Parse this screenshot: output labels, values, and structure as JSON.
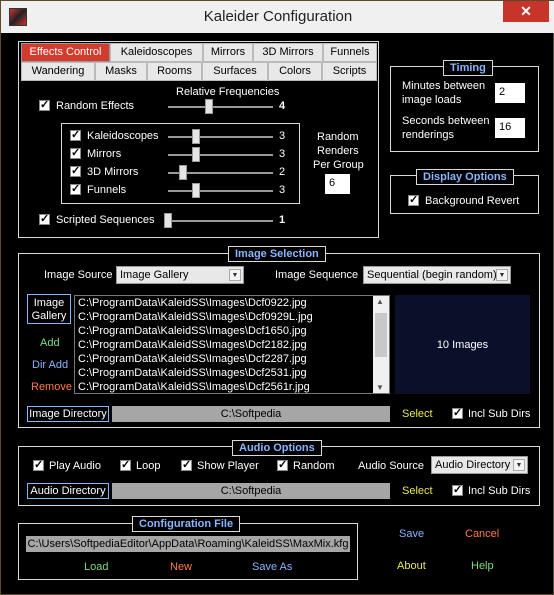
{
  "window": {
    "title": "Kaleider Configuration",
    "close": "✕"
  },
  "tabs": {
    "row1": [
      "Effects Control",
      "Kaleidoscopes",
      "Mirrors",
      "3D Mirrors",
      "Funnels"
    ],
    "row2": [
      "Wandering",
      "Masks",
      "Rooms",
      "Surfaces",
      "Colors",
      "Scripts"
    ],
    "active": "Effects Control"
  },
  "effects": {
    "relative_frequencies": "Relative Frequencies",
    "random_effects": {
      "label": "Random Effects",
      "value": "4"
    },
    "items": [
      {
        "label": "Kaleidoscopes",
        "value": "3"
      },
      {
        "label": "Mirrors",
        "value": "3"
      },
      {
        "label": "3D Mirrors",
        "value": "2"
      },
      {
        "label": "Funnels",
        "value": "3"
      }
    ],
    "scripted": {
      "label": "Scripted Sequences",
      "value": "1"
    },
    "random_renders": "Random\nRenders\nPer Group",
    "random_renders_lines": [
      "Random",
      "Renders",
      "Per Group"
    ],
    "random_renders_value": "6"
  },
  "timing": {
    "title": "Timing",
    "minutes_label": [
      "Minutes between",
      "image loads"
    ],
    "minutes_value": "2",
    "seconds_label": [
      "Seconds between",
      "renderings"
    ],
    "seconds_value": "16"
  },
  "display": {
    "title": "Display Options",
    "background_revert": "Background Revert"
  },
  "image_selection": {
    "title": "Image Selection",
    "source_label": "Image Source",
    "source_value": "Image Gallery",
    "sequence_label": "Image Sequence",
    "sequence_value": "Sequential (begin random)",
    "gallery_button": [
      "Image",
      "Gallery"
    ],
    "add": "Add",
    "dir_add": "Dir Add",
    "remove": "Remove",
    "files": [
      "C:\\ProgramData\\KaleidSS\\Images\\Dcf0922.jpg",
      "C:\\ProgramData\\KaleidSS\\Images\\Dcf0929L.jpg",
      "C:\\ProgramData\\KaleidSS\\Images\\Dcf1650.jpg",
      "C:\\ProgramData\\KaleidSS\\Images\\Dcf2182.jpg",
      "C:\\ProgramData\\KaleidSS\\Images\\Dcf2287.jpg",
      "C:\\ProgramData\\KaleidSS\\Images\\Dcf2531.jpg",
      "C:\\ProgramData\\KaleidSS\\Images\\Dcf2561r.jpg"
    ],
    "count": "10 Images",
    "directory_label": "Image Directory",
    "directory_value": "C:\\Softpedia",
    "select": "Select",
    "incl_sub_dirs": "Incl Sub Dirs"
  },
  "audio": {
    "title": "Audio Options",
    "play_audio": "Play Audio",
    "loop": "Loop",
    "show_player": "Show Player",
    "random": "Random",
    "source_label": "Audio Source",
    "source_value": "Audio Directory",
    "directory_label": "Audio Directory",
    "directory_value": "C:\\Softpedia",
    "select": "Select",
    "incl_sub_dirs": "Incl Sub Dirs"
  },
  "config_file": {
    "title": "Configuration File",
    "path": "C:\\Users\\SoftpediaEditor\\AppData\\Roaming\\KaleidSS\\MaxMix.kfg",
    "load": "Load",
    "new": "New",
    "save_as": "Save As"
  },
  "actions": {
    "save": "Save",
    "cancel": "Cancel",
    "about": "About",
    "help": "Help"
  },
  "colors": {
    "accent_blue": "#8ab4ff",
    "green": "#7ddc7d",
    "red_orange": "#ff7a4a",
    "active_tab": "#d33b2c"
  }
}
